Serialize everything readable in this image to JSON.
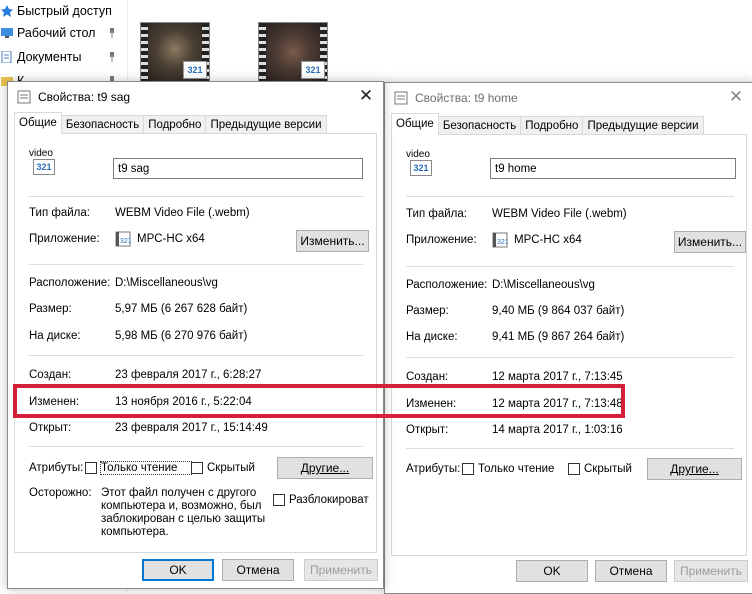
{
  "explorer": {
    "nav_items": [
      {
        "label": "Быстрый доступ",
        "icon": "star-icon"
      },
      {
        "label": "Рабочий стол",
        "icon": "desktop-folder-icon"
      },
      {
        "label": "Документы",
        "icon": "documents-folder-icon"
      },
      {
        "label": "К",
        "icon": "folder-icon"
      }
    ],
    "thumbnails": [
      {
        "badge": "321"
      },
      {
        "badge": "321"
      }
    ]
  },
  "dialog_left": {
    "title": "Свойства: t9 sag",
    "close": "✕",
    "tabs": [
      "Общие",
      "Безопасность",
      "Подробно",
      "Предыдущие версии"
    ],
    "icon_label": "video",
    "icon_badge": "321",
    "file_name": "t9 sag",
    "type_label": "Тип файла:",
    "type_value": "WEBM Video File (.webm)",
    "app_label": "Приложение:",
    "app_value": "MPC-HC x64",
    "change_button": "Изменить...",
    "location_label": "Расположение:",
    "location_value": "D:\\Miscellaneous\\vg",
    "size_label": "Размер:",
    "size_value": "5,97 МБ (6 267 628 байт)",
    "disk_label": "На диске:",
    "disk_value": "5,98 МБ (6 270 976 байт)",
    "created_label": "Создан:",
    "created_value": "23 февраля 2017 г., 6:28:27",
    "modified_label": "Изменен:",
    "modified_value": "13 ноября 2016 г., 5:22:04",
    "opened_label": "Открыт:",
    "opened_value": "23 февраля 2017 г., 15:14:49",
    "attributes_label": "Атрибуты:",
    "readonly_label": "Только чтение",
    "hidden_label": "Скрытый",
    "other_button": "Другие...",
    "warning_label": "Осторожно:",
    "warning_lines": [
      "Этот файл получен с другого",
      "компьютера и, возможно, был",
      "заблокирован с целью защиты",
      "компьютера."
    ],
    "unblock_label": "Разблокироват",
    "ok_button": "OK",
    "cancel_button": "Отмена",
    "apply_button": "Применить"
  },
  "dialog_right": {
    "title": "Свойства: t9 home",
    "close": "✕",
    "tabs": [
      "Общие",
      "Безопасность",
      "Подробно",
      "Предыдущие версии"
    ],
    "icon_label": "video",
    "icon_badge": "321",
    "file_name": "t9 home",
    "type_label": "Тип файла:",
    "type_value": "WEBM Video File (.webm)",
    "app_label": "Приложение:",
    "app_value": "MPC-HC x64",
    "change_button": "Изменить...",
    "location_label": "Расположение:",
    "location_value": "D:\\Miscellaneous\\vg",
    "size_label": "Размер:",
    "size_value": "9,40 МБ (9 864 037 байт)",
    "disk_label": "На диске:",
    "disk_value": "9,41 МБ (9 867 264 байт)",
    "created_label": "Создан:",
    "created_value": "12 марта 2017 г., 7:13:45",
    "modified_label": "Изменен:",
    "modified_value": "12 марта 2017 г., 7:13:48",
    "opened_label": "Открыт:",
    "opened_value": "14 марта 2017 г., 1:03:16",
    "attributes_label": "Атрибуты:",
    "readonly_label": "Только чтение",
    "hidden_label": "Скрытый",
    "other_button": "Другие...",
    "ok_button": "OK",
    "cancel_button": "Отмена",
    "apply_button": "Применить"
  },
  "colors": {
    "highlight": "#d4213a",
    "focus_border": "#0078d7"
  }
}
